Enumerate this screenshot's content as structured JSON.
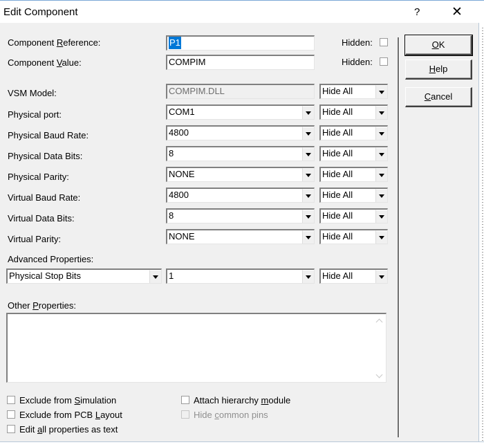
{
  "window": {
    "title": "Edit Component",
    "help_glyph": "?",
    "close_glyph": "✕"
  },
  "labels": {
    "ref_pre": "Component ",
    "ref_key": "R",
    "ref_post": "eference:",
    "val_pre": "Component ",
    "val_key": "V",
    "val_post": "alue:",
    "hidden": "Hidden:",
    "vsm_model": "VSM Model:",
    "physical_port": "Physical port:",
    "physical_baud": "Physical Baud Rate:",
    "physical_data_bits": "Physical Data Bits:",
    "physical_parity": "Physical Parity:",
    "virtual_baud": "Virtual Baud Rate:",
    "virtual_data_bits": "Virtual Data Bits:",
    "virtual_parity": "Virtual Parity:",
    "advanced": "Advanced Properties:",
    "other_pre": "Other ",
    "other_key": "P",
    "other_post": "roperties:"
  },
  "fields": {
    "component_reference": "P1",
    "component_value": "COMPIM",
    "vsm_model": "COMPIM.DLL",
    "physical_port": "COM1",
    "physical_baud": "4800",
    "physical_data_bits": "8",
    "physical_parity": "NONE",
    "virtual_baud": "4800",
    "virtual_data_bits": "8",
    "virtual_parity": "NONE",
    "advanced_property": "Physical Stop Bits",
    "advanced_value": "1",
    "other_properties": ""
  },
  "visibility": "Hide All",
  "buttons": {
    "ok_key": "O",
    "ok_post": "K",
    "help_key": "H",
    "help_post": "elp",
    "cancel_key": "C",
    "cancel_post": "ancel"
  },
  "checkboxes": {
    "excl_sim_pre": "Exclude from ",
    "excl_sim_key": "S",
    "excl_sim_post": "imulation",
    "excl_pcb_pre": "Exclude from PCB ",
    "excl_pcb_key": "L",
    "excl_pcb_post": "ayout",
    "edit_all_pre": "Edit ",
    "edit_all_key": "a",
    "edit_all_post": "ll properties as text",
    "attach_pre": "Attach hierarchy ",
    "attach_key": "m",
    "attach_post": "odule",
    "hide_pins_pre": "Hide ",
    "hide_pins_key": "c",
    "hide_pins_post": "ommon pins"
  },
  "colors": {
    "face": "#f0f0f0",
    "selection": "#0078d7",
    "disabled_text": "#8f8f8f"
  }
}
